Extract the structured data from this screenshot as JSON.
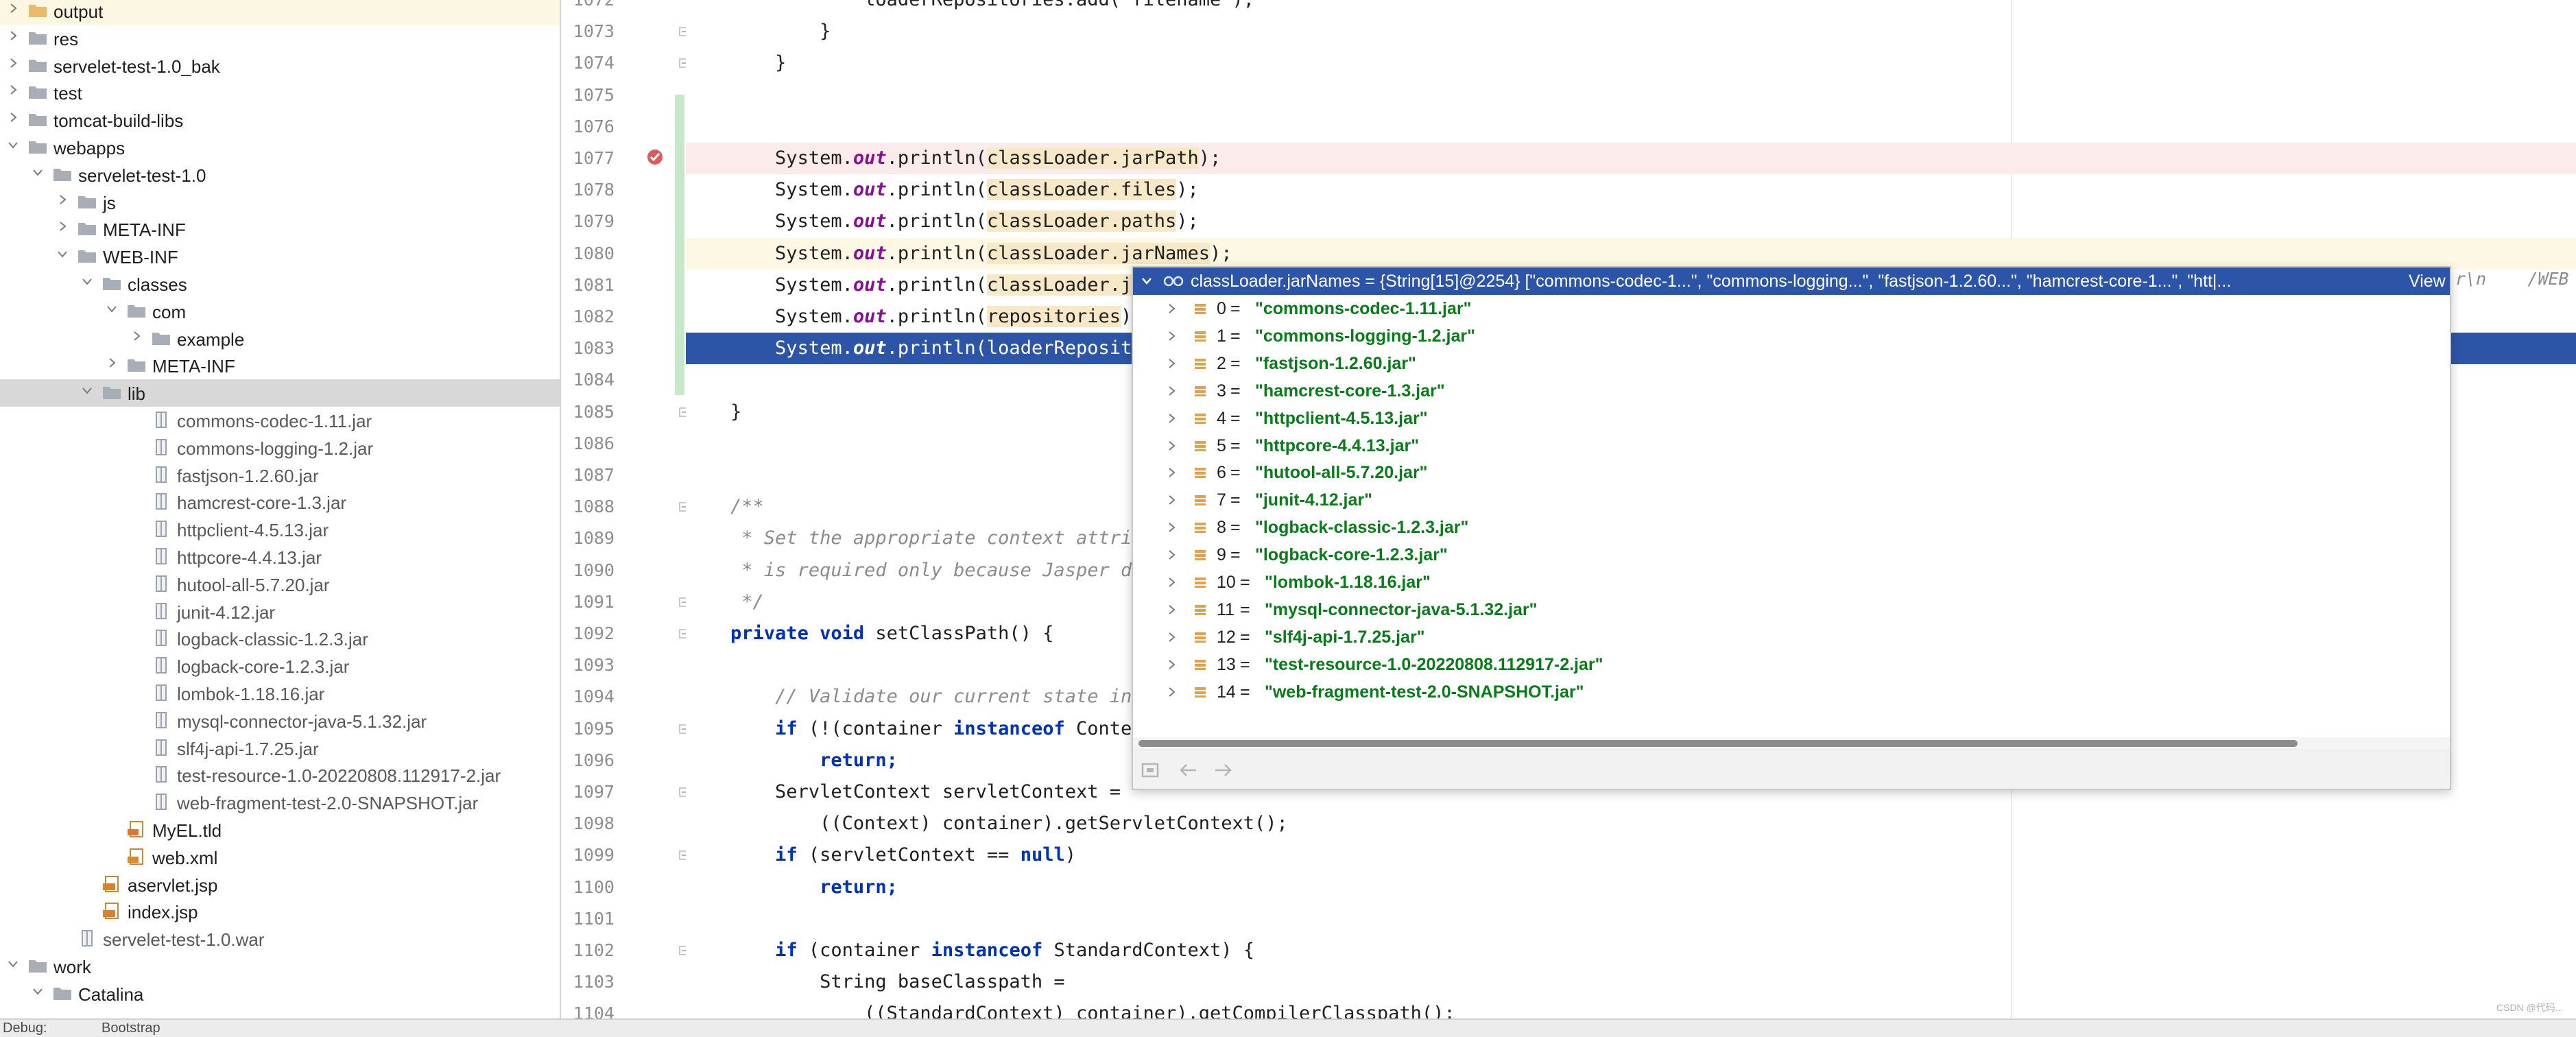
{
  "tree": {
    "items": [
      {
        "label": "output",
        "depth": 0,
        "chevron": "right",
        "icon": "folder-icon",
        "state": "hl"
      },
      {
        "label": "res",
        "depth": 0,
        "chevron": "right",
        "icon": "folder-icon"
      },
      {
        "label": "servelet-test-1.0_bak",
        "depth": 0,
        "chevron": "right",
        "icon": "folder-icon"
      },
      {
        "label": "test",
        "depth": 0,
        "chevron": "right",
        "icon": "folder-icon"
      },
      {
        "label": "tomcat-build-libs",
        "depth": 0,
        "chevron": "right",
        "icon": "folder-icon"
      },
      {
        "label": "webapps",
        "depth": 0,
        "chevron": "down",
        "icon": "folder-icon"
      },
      {
        "label": "servelet-test-1.0",
        "depth": 1,
        "chevron": "down",
        "icon": "folder-icon"
      },
      {
        "label": "js",
        "depth": 2,
        "chevron": "right",
        "icon": "folder-icon"
      },
      {
        "label": "META-INF",
        "depth": 2,
        "chevron": "right",
        "icon": "folder-icon"
      },
      {
        "label": "WEB-INF",
        "depth": 2,
        "chevron": "down",
        "icon": "folder-icon"
      },
      {
        "label": "classes",
        "depth": 3,
        "chevron": "down",
        "icon": "folder-icon"
      },
      {
        "label": "com",
        "depth": 4,
        "chevron": "down",
        "icon": "folder-icon"
      },
      {
        "label": "example",
        "depth": 5,
        "chevron": "right",
        "icon": "folder-icon"
      },
      {
        "label": "META-INF",
        "depth": 4,
        "chevron": "right",
        "icon": "folder-icon"
      },
      {
        "label": "lib",
        "depth": 3,
        "chevron": "down",
        "icon": "folder-icon",
        "state": "sel"
      },
      {
        "label": "commons-codec-1.11.jar",
        "depth": 5,
        "icon": "jar-icon"
      },
      {
        "label": "commons-logging-1.2.jar",
        "depth": 5,
        "icon": "jar-icon"
      },
      {
        "label": "fastjson-1.2.60.jar",
        "depth": 5,
        "icon": "jar-icon"
      },
      {
        "label": "hamcrest-core-1.3.jar",
        "depth": 5,
        "icon": "jar-icon"
      },
      {
        "label": "httpclient-4.5.13.jar",
        "depth": 5,
        "icon": "jar-icon"
      },
      {
        "label": "httpcore-4.4.13.jar",
        "depth": 5,
        "icon": "jar-icon"
      },
      {
        "label": "hutool-all-5.7.20.jar",
        "depth": 5,
        "icon": "jar-icon"
      },
      {
        "label": "junit-4.12.jar",
        "depth": 5,
        "icon": "jar-icon"
      },
      {
        "label": "logback-classic-1.2.3.jar",
        "depth": 5,
        "icon": "jar-icon"
      },
      {
        "label": "logback-core-1.2.3.jar",
        "depth": 5,
        "icon": "jar-icon"
      },
      {
        "label": "lombok-1.18.16.jar",
        "depth": 5,
        "icon": "jar-icon"
      },
      {
        "label": "mysql-connector-java-5.1.32.jar",
        "depth": 5,
        "icon": "jar-icon"
      },
      {
        "label": "slf4j-api-1.7.25.jar",
        "depth": 5,
        "icon": "jar-icon"
      },
      {
        "label": "test-resource-1.0-20220808.112917-2.jar",
        "depth": 5,
        "icon": "jar-icon"
      },
      {
        "label": "web-fragment-test-2.0-SNAPSHOT.jar",
        "depth": 5,
        "icon": "jar-icon"
      },
      {
        "label": "MyEL.tld",
        "depth": 4,
        "icon": "tld-file-icon"
      },
      {
        "label": "web.xml",
        "depth": 4,
        "icon": "xml-file-icon"
      },
      {
        "label": "aservlet.jsp",
        "depth": 3,
        "icon": "jsp-file-icon"
      },
      {
        "label": "index.jsp",
        "depth": 3,
        "icon": "jsp-file-icon"
      },
      {
        "label": "servelet-test-1.0.war",
        "depth": 2,
        "icon": "jar-icon"
      },
      {
        "label": "work",
        "depth": 0,
        "chevron": "down",
        "icon": "folder-icon"
      },
      {
        "label": "Catalina",
        "depth": 1,
        "chevron": "down",
        "icon": "folder-icon"
      }
    ]
  },
  "editor": {
    "lines": [
      {
        "n": "1072",
        "code": [
          {
            "t": "            loaderRepositories.add(\"filename\");"
          }
        ]
      },
      {
        "n": "1073",
        "code": [
          {
            "t": "        }"
          }
        ]
      },
      {
        "n": "1074",
        "code": [
          {
            "t": "    }"
          }
        ]
      },
      {
        "n": "1075",
        "code": []
      },
      {
        "n": "1076",
        "code": []
      },
      {
        "n": "1077",
        "state": "bp",
        "code": [
          {
            "t": "    System."
          },
          {
            "t": "out",
            "c": "fld"
          },
          {
            "t": ".println("
          },
          {
            "t": "classLoader.jarPath",
            "c": "var"
          },
          {
            "t": ");"
          }
        ]
      },
      {
        "n": "1078",
        "code": [
          {
            "t": "    System."
          },
          {
            "t": "out",
            "c": "fld"
          },
          {
            "t": ".println("
          },
          {
            "t": "classLoader.files",
            "c": "var"
          },
          {
            "t": ");"
          }
        ]
      },
      {
        "n": "1079",
        "code": [
          {
            "t": "    System."
          },
          {
            "t": "out",
            "c": "fld"
          },
          {
            "t": ".println("
          },
          {
            "t": "classLoader.paths",
            "c": "var"
          },
          {
            "t": ");"
          }
        ]
      },
      {
        "n": "1080",
        "state": "cur",
        "code": [
          {
            "t": "    System."
          },
          {
            "t": "out",
            "c": "fld"
          },
          {
            "t": ".println("
          },
          {
            "t": "classLoader.jarNames",
            "c": "var"
          },
          {
            "t": ");"
          }
        ]
      },
      {
        "n": "1081",
        "code": [
          {
            "t": "    System."
          },
          {
            "t": "out",
            "c": "fld"
          },
          {
            "t": ".println("
          },
          {
            "t": "classLoader.j",
            "c": "var"
          }
        ]
      },
      {
        "n": "1082",
        "code": [
          {
            "t": "    System."
          },
          {
            "t": "out",
            "c": "fld"
          },
          {
            "t": ".println("
          },
          {
            "t": "repositories",
            "c": "var"
          },
          {
            "t": ")"
          }
        ]
      },
      {
        "n": "1083",
        "state": "exec",
        "code": [
          {
            "t": "    System."
          },
          {
            "t": "out",
            "c": "fld"
          },
          {
            "t": ".println(loaderReposit"
          }
        ]
      },
      {
        "n": "1084",
        "code": []
      },
      {
        "n": "1085",
        "code": [
          {
            "t": "}"
          }
        ]
      },
      {
        "n": "1086",
        "code": []
      },
      {
        "n": "1087",
        "code": []
      },
      {
        "n": "1088",
        "code": [
          {
            "t": "/**",
            "c": "cmt"
          }
        ]
      },
      {
        "n": "1089",
        "code": [
          {
            "t": " * Set the appropriate context attri",
            "c": "cmt"
          }
        ]
      },
      {
        "n": "1090",
        "code": [
          {
            "t": " * is required only because Jasper d",
            "c": "cmt"
          }
        ]
      },
      {
        "n": "1091",
        "code": [
          {
            "t": " */",
            "c": "cmt"
          }
        ]
      },
      {
        "n": "1092",
        "code": [
          {
            "t": "private void",
            "c": "kw"
          },
          {
            "t": " setClassPath() {"
          }
        ]
      },
      {
        "n": "1093",
        "code": []
      },
      {
        "n": "1094",
        "code": [
          {
            "t": "    "
          },
          {
            "t": "// Validate our current state in",
            "c": "cmt"
          }
        ]
      },
      {
        "n": "1095",
        "code": [
          {
            "t": "    "
          },
          {
            "t": "if",
            "c": "kw"
          },
          {
            "t": " (!(container "
          },
          {
            "t": "instanceof",
            "c": "kw"
          },
          {
            "t": " Conte"
          }
        ]
      },
      {
        "n": "1096",
        "code": [
          {
            "t": "        "
          },
          {
            "t": "return;",
            "c": "kw"
          }
        ]
      },
      {
        "n": "1097",
        "code": [
          {
            "t": "    ServletContext servletContext ="
          }
        ]
      },
      {
        "n": "1098",
        "code": [
          {
            "t": "        ((Context) container).getServletContext();"
          }
        ]
      },
      {
        "n": "1099",
        "code": [
          {
            "t": "    "
          },
          {
            "t": "if",
            "c": "kw"
          },
          {
            "t": " (servletContext == "
          },
          {
            "t": "null",
            "c": "kw"
          },
          {
            "t": ")"
          }
        ]
      },
      {
        "n": "1100",
        "code": [
          {
            "t": "        "
          },
          {
            "t": "return;",
            "c": "kw"
          }
        ]
      },
      {
        "n": "1101",
        "code": []
      },
      {
        "n": "1102",
        "code": [
          {
            "t": "    "
          },
          {
            "t": "if",
            "c": "kw"
          },
          {
            "t": " (container "
          },
          {
            "t": "instanceof",
            "c": "kw"
          },
          {
            "t": " StandardContext) {"
          }
        ]
      },
      {
        "n": "1103",
        "code": [
          {
            "t": "        String baseClasspath ="
          }
        ]
      },
      {
        "n": "1104",
        "code": [
          {
            "t": "            ((StandardContext) container).getCompilerClasspath();"
          }
        ]
      }
    ],
    "right_overflow": "r\\n    /WEB"
  },
  "popup": {
    "header": "classLoader.jarNames = {String[15]@2254} [\"commons-codec-1...\", \"commons-logging...\", \"fastjson-1.2.60...\", \"hamcrest-core-1...\", \"htt|...",
    "view_link": "View",
    "items": [
      {
        "index": "0",
        "value": "\"commons-codec-1.11.jar\""
      },
      {
        "index": "1",
        "value": "\"commons-logging-1.2.jar\""
      },
      {
        "index": "2",
        "value": "\"fastjson-1.2.60.jar\""
      },
      {
        "index": "3",
        "value": "\"hamcrest-core-1.3.jar\""
      },
      {
        "index": "4",
        "value": "\"httpclient-4.5.13.jar\""
      },
      {
        "index": "5",
        "value": "\"httpcore-4.4.13.jar\""
      },
      {
        "index": "6",
        "value": "\"hutool-all-5.7.20.jar\""
      },
      {
        "index": "7",
        "value": "\"junit-4.12.jar\""
      },
      {
        "index": "8",
        "value": "\"logback-classic-1.2.3.jar\""
      },
      {
        "index": "9",
        "value": "\"logback-core-1.2.3.jar\""
      },
      {
        "index": "10",
        "value": "\"lombok-1.18.16.jar\""
      },
      {
        "index": "11",
        "value": "\"mysql-connector-java-5.1.32.jar\""
      },
      {
        "index": "12",
        "value": "\"slf4j-api-1.7.25.jar\""
      },
      {
        "index": "13",
        "value": "\"test-resource-1.0-20220808.112917-2.jar\""
      },
      {
        "index": "14",
        "value": "\"web-fragment-test-2.0-SNAPSHOT.jar\""
      }
    ]
  },
  "bottom": {
    "debug_label": "Debug:",
    "tab_label": "Bootstrap",
    "watermark": "CSDN @代码..."
  },
  "colors": {
    "selection_blue": "#2d55a7",
    "string_green": "#067d17",
    "keyword_blue": "#0033b3",
    "field_purple": "#871094"
  }
}
